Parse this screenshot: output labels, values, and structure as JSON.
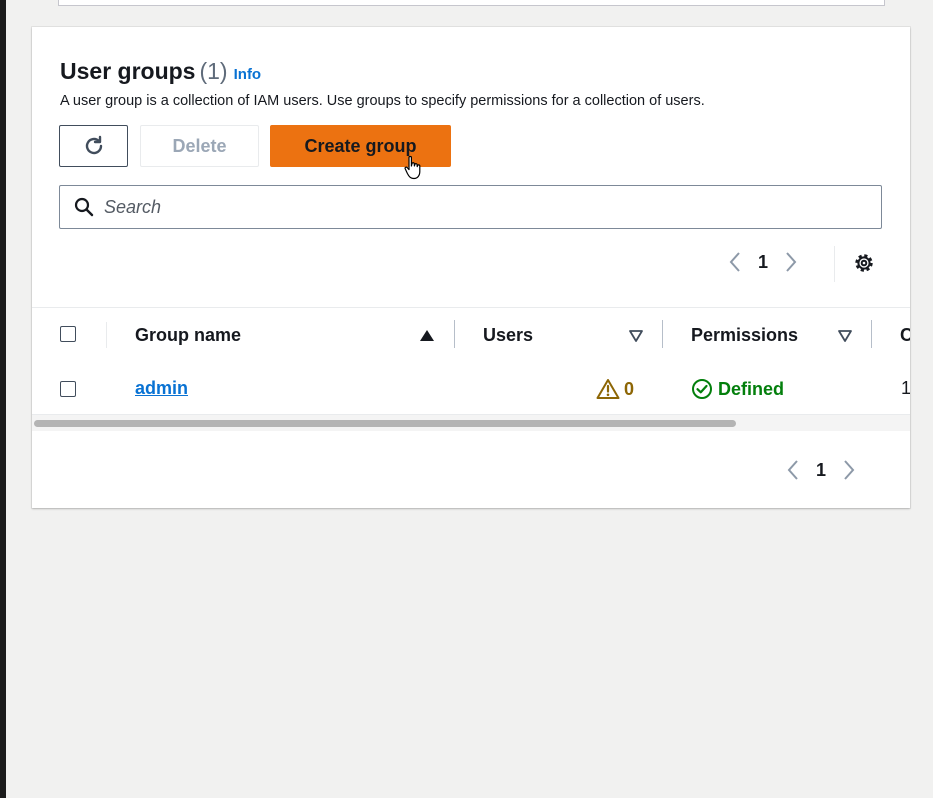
{
  "section": {
    "title": "User groups",
    "count": "(1)",
    "info_link": "Info",
    "description": "A user group is a collection of IAM users. Use groups to specify permissions for a collection of users."
  },
  "toolbar": {
    "refresh_icon": "refresh-icon",
    "delete_label": "Delete",
    "create_label": "Create group"
  },
  "search": {
    "placeholder": "Search",
    "value": ""
  },
  "pagination": {
    "current_page": "1"
  },
  "table": {
    "columns": [
      {
        "label": "Group name",
        "sort": "ascending"
      },
      {
        "label": "Users",
        "sort": "none"
      },
      {
        "label": "Permissions",
        "sort": "none"
      },
      {
        "label": "C",
        "sort": "none"
      }
    ],
    "rows": [
      {
        "group_name": "admin",
        "users": "0",
        "permissions": "Defined",
        "creation": "1"
      }
    ]
  },
  "colors": {
    "primary_button": "#ec7211",
    "link": "#0972d3",
    "success": "#037f0c",
    "warning": "#8d6605"
  }
}
